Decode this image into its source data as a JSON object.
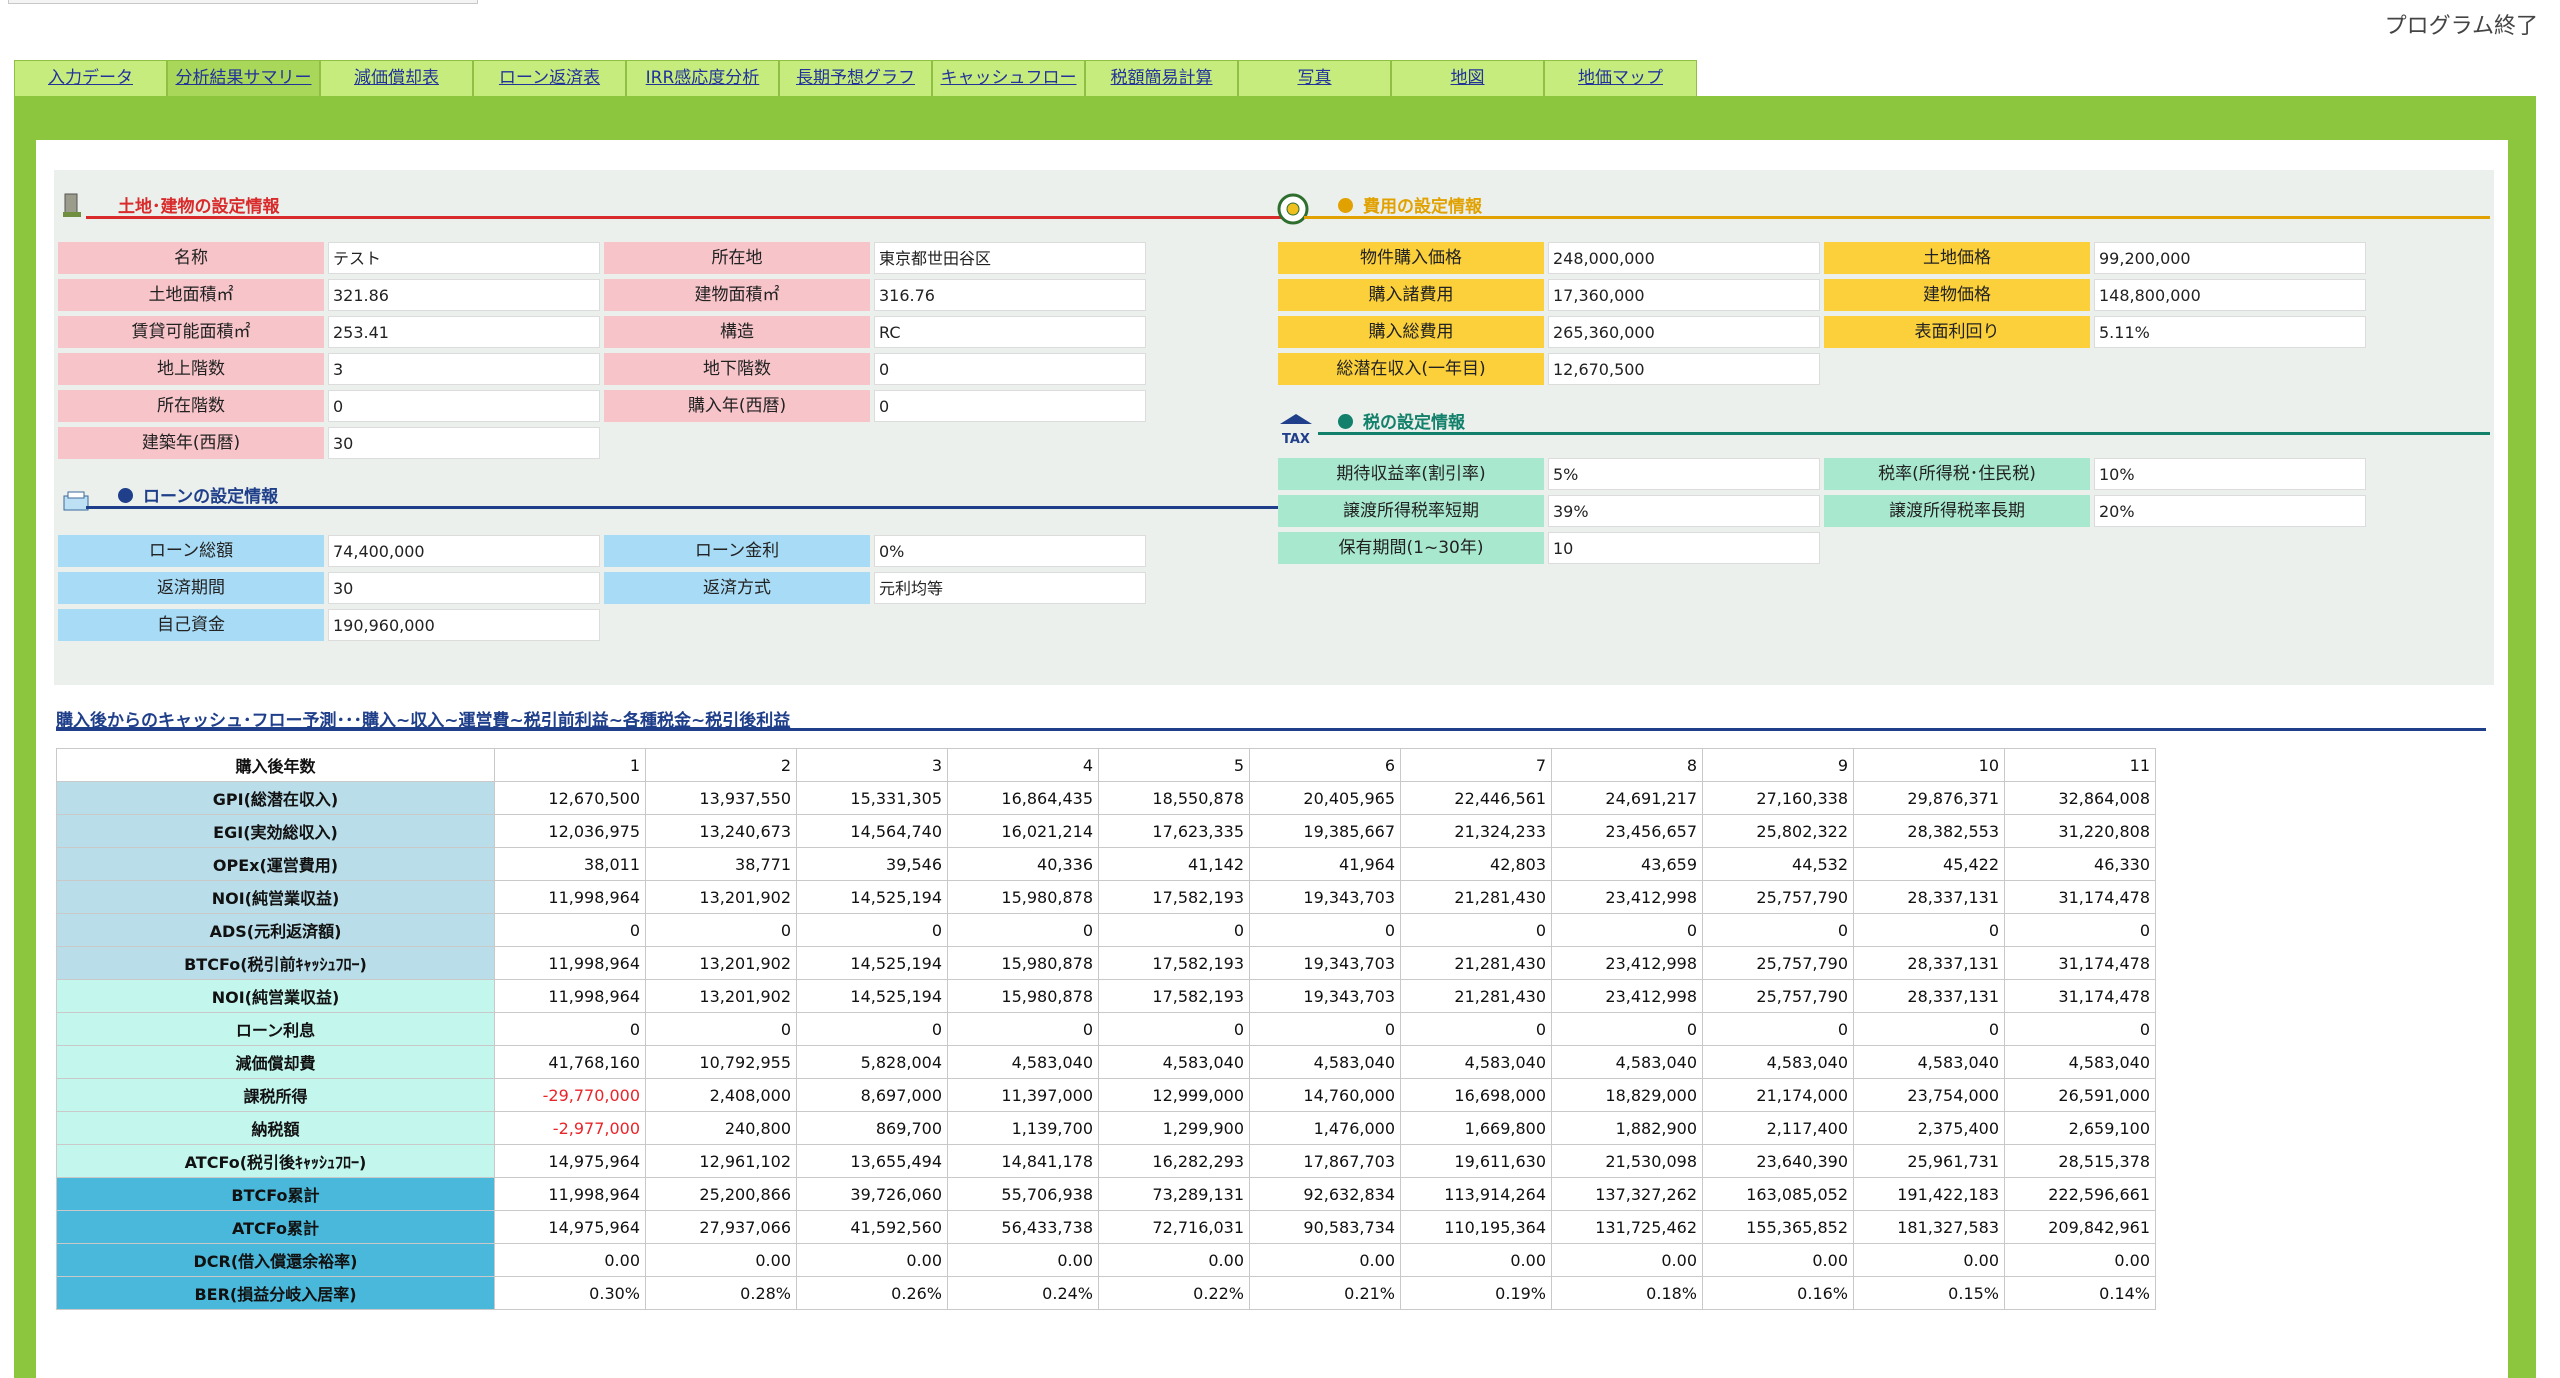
{
  "header": {
    "quit_label": "プログラム終了"
  },
  "tabs": [
    {
      "label": "入力データ",
      "active": false
    },
    {
      "label": "分析結果サマリー",
      "active": true
    },
    {
      "label": "減価償却表",
      "active": false
    },
    {
      "label": "ローン返済表",
      "active": false
    },
    {
      "label": "IRR感応度分析",
      "active": false
    },
    {
      "label": "長期予想グラフ",
      "active": false
    },
    {
      "label": "キャッシュフロー",
      "active": false
    },
    {
      "label": "税額簡易計算",
      "active": false
    },
    {
      "label": "写真",
      "active": false
    },
    {
      "label": "地図",
      "active": false
    },
    {
      "label": "地価マップ",
      "active": false
    }
  ],
  "land": {
    "title": "土地･建物の設定情報",
    "name_label": "名称",
    "name_value": "テスト",
    "location_label": "所在地",
    "location_value": "東京都世田谷区",
    "land_area_label": "土地面積㎡",
    "land_area_value": "321.86",
    "building_area_label": "建物面積㎡",
    "building_area_value": "316.76",
    "rentable_area_label": "賃貸可能面積㎡",
    "rentable_area_value": "253.41",
    "structure_label": "構造",
    "structure_value": "RC",
    "floors_above_label": "地上階数",
    "floors_above_value": "3",
    "floors_below_label": "地下階数",
    "floors_below_value": "0",
    "floor_label": "所在階数",
    "floor_value": "0",
    "purchase_year_label": "購入年(西暦)",
    "purchase_year_value": "0",
    "built_year_label": "建築年(西暦)",
    "built_year_value": "30"
  },
  "loan": {
    "title": "ローンの設定情報",
    "total_label": "ローン総額",
    "total_value": "74,400,000",
    "rate_label": "ローン金利",
    "rate_value": "0%",
    "term_label": "返済期間",
    "term_value": "30",
    "method_label": "返済方式",
    "method_value": "元利均等",
    "equity_label": "自己資金",
    "equity_value": "190,960,000"
  },
  "cost": {
    "title": "費用の設定情報",
    "price_label": "物件購入価格",
    "price_value": "248,000,000",
    "land_price_label": "土地価格",
    "land_price_value": "99,200,000",
    "expenses_label": "購入諸費用",
    "expenses_value": "17,360,000",
    "building_price_label": "建物価格",
    "building_price_value": "148,800,000",
    "total_label": "購入総費用",
    "total_value": "265,360,000",
    "yield_label": "表面利回り",
    "yield_value": "5.11%",
    "gpi_label": "総潜在収入(一年目)",
    "gpi_value": "12,670,500"
  },
  "tax": {
    "title": "税の設定情報",
    "icon_text": "TAX",
    "discount_label": "期待収益率(割引率)",
    "discount_value": "5%",
    "income_tax_label": "税率(所得税･住民税)",
    "income_tax_value": "10%",
    "transfer_short_label": "譲渡所得税率短期",
    "transfer_short_value": "39%",
    "transfer_long_label": "譲渡所得税率長期",
    "transfer_long_value": "20%",
    "holding_label": "保有期間(1~30年)",
    "holding_value": "10"
  },
  "cashflow": {
    "title": "購入後からのキャッシュ･フロー予測･･･購入~収入~運営費~税引前利益~各種税金~税引後利益",
    "header_label": "購入後年数",
    "years": [
      "1",
      "2",
      "3",
      "4",
      "5",
      "6",
      "7",
      "8",
      "9",
      "10",
      "11"
    ],
    "rows": [
      {
        "label": "GPI(総潜在収入)",
        "style": "lb",
        "values": [
          "12,670,500",
          "13,937,550",
          "15,331,305",
          "16,864,435",
          "18,550,878",
          "20,405,965",
          "22,446,561",
          "24,691,217",
          "27,160,338",
          "29,876,371",
          "32,864,008"
        ]
      },
      {
        "label": "EGI(実効総収入)",
        "style": "lb",
        "values": [
          "12,036,975",
          "13,240,673",
          "14,564,740",
          "16,021,214",
          "17,623,335",
          "19,385,667",
          "21,324,233",
          "23,456,657",
          "25,802,322",
          "28,382,553",
          "31,220,808"
        ]
      },
      {
        "label": "OPEx(運営費用)",
        "style": "lb",
        "values": [
          "38,011",
          "38,771",
          "39,546",
          "40,336",
          "41,142",
          "41,964",
          "42,803",
          "43,659",
          "44,532",
          "45,422",
          "46,330"
        ]
      },
      {
        "label": "NOI(純営業収益)",
        "style": "lb",
        "values": [
          "11,998,964",
          "13,201,902",
          "14,525,194",
          "15,980,878",
          "17,582,193",
          "19,343,703",
          "21,281,430",
          "23,412,998",
          "25,757,790",
          "28,337,131",
          "31,174,478"
        ]
      },
      {
        "label": "ADS(元利返済額)",
        "style": "lb",
        "values": [
          "0",
          "0",
          "0",
          "0",
          "0",
          "0",
          "0",
          "0",
          "0",
          "0",
          "0"
        ]
      },
      {
        "label": "BTCFo(税引前ｷｬｯｼｭﾌﾛｰ)",
        "style": "lb",
        "values": [
          "11,998,964",
          "13,201,902",
          "14,525,194",
          "15,980,878",
          "17,582,193",
          "19,343,703",
          "21,281,430",
          "23,412,998",
          "25,757,790",
          "28,337,131",
          "31,174,478"
        ]
      },
      {
        "label": "NOI(純営業収益)",
        "style": "lc",
        "values": [
          "11,998,964",
          "13,201,902",
          "14,525,194",
          "15,980,878",
          "17,582,193",
          "19,343,703",
          "21,281,430",
          "23,412,998",
          "25,757,790",
          "28,337,131",
          "31,174,478"
        ]
      },
      {
        "label": "ローン利息",
        "style": "lc",
        "values": [
          "0",
          "0",
          "0",
          "0",
          "0",
          "0",
          "0",
          "0",
          "0",
          "0",
          "0"
        ]
      },
      {
        "label": "減価償却費",
        "style": "lc",
        "values": [
          "41,768,160",
          "10,792,955",
          "5,828,004",
          "4,583,040",
          "4,583,040",
          "4,583,040",
          "4,583,040",
          "4,583,040",
          "4,583,040",
          "4,583,040",
          "4,583,040"
        ]
      },
      {
        "label": "課税所得",
        "style": "lc",
        "values": [
          "-29,770,000",
          "2,408,000",
          "8,697,000",
          "11,397,000",
          "12,999,000",
          "14,760,000",
          "16,698,000",
          "18,829,000",
          "21,174,000",
          "23,754,000",
          "26,591,000"
        ]
      },
      {
        "label": "納税額",
        "style": "lc",
        "values": [
          "-2,977,000",
          "240,800",
          "869,700",
          "1,139,700",
          "1,299,900",
          "1,476,000",
          "1,669,800",
          "1,882,900",
          "2,117,400",
          "2,375,400",
          "2,659,100"
        ]
      },
      {
        "label": "ATCFo(税引後ｷｬｯｼｭﾌﾛｰ)",
        "style": "lc",
        "values": [
          "14,975,964",
          "12,961,102",
          "13,655,494",
          "14,841,178",
          "16,282,293",
          "17,867,703",
          "19,611,630",
          "21,530,098",
          "23,640,390",
          "25,961,731",
          "28,515,378"
        ]
      },
      {
        "label": "BTCFo累計",
        "style": "db",
        "values": [
          "11,998,964",
          "25,200,866",
          "39,726,060",
          "55,706,938",
          "73,289,131",
          "92,632,834",
          "113,914,264",
          "137,327,262",
          "163,085,052",
          "191,422,183",
          "222,596,661"
        ]
      },
      {
        "label": "ATCFo累計",
        "style": "db",
        "values": [
          "14,975,964",
          "27,937,066",
          "41,592,560",
          "56,433,738",
          "72,716,031",
          "90,583,734",
          "110,195,364",
          "131,725,462",
          "155,365,852",
          "181,327,583",
          "209,842,961"
        ]
      },
      {
        "label": "DCR(借入償還余裕率)",
        "style": "db",
        "values": [
          "0.00",
          "0.00",
          "0.00",
          "0.00",
          "0.00",
          "0.00",
          "0.00",
          "0.00",
          "0.00",
          "0.00",
          "0.00"
        ]
      },
      {
        "label": "BER(損益分岐入居率)",
        "style": "db",
        "values": [
          "0.30%",
          "0.28%",
          "0.26%",
          "0.24%",
          "0.22%",
          "0.21%",
          "0.19%",
          "0.18%",
          "0.16%",
          "0.15%",
          "0.14%"
        ]
      }
    ]
  },
  "colors": {
    "frame": "#8cc63f",
    "tab": "#c7ec7e",
    "land_red": "#d92b2b",
    "cost_gold": "#e1a100",
    "tax_teal": "#12806a",
    "loan_navy": "#1f3f8a",
    "negative": "#e8252a"
  }
}
